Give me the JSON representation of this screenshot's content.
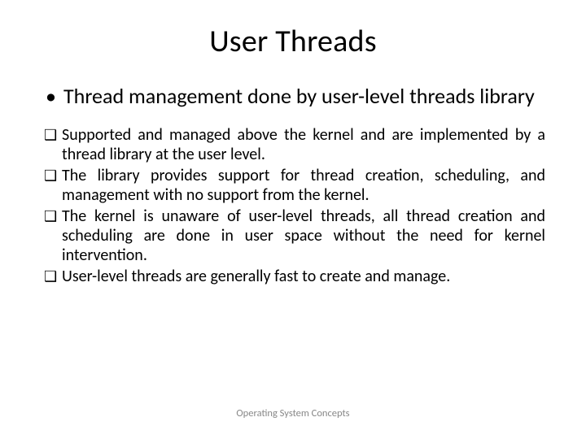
{
  "slide": {
    "title": "User Threads",
    "main_bullet": "Thread management done by user-level threads library",
    "sub_bullets": [
      "Supported and managed above the kernel and are implemented by a thread library at the user level.",
      "The library provides support for thread creation, scheduling, and management with no support from the kernel.",
      "The kernel is unaware of user-level threads, all thread creation and scheduling are done in user space without the need for kernel intervention.",
      " User-level threads are generally fast to create and manage."
    ],
    "footer": "Operating System Concepts"
  }
}
